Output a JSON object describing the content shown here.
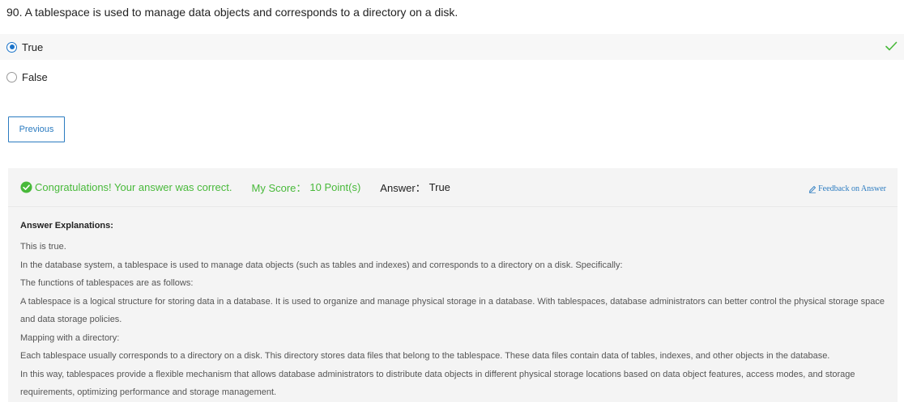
{
  "question": {
    "text": "90. A tablespace is used to manage data objects and corresponds to a directory on a disk."
  },
  "options": [
    {
      "label": "True",
      "selected": true,
      "correct": true
    },
    {
      "label": "False",
      "selected": false,
      "correct": false
    }
  ],
  "nav": {
    "previous_label": "Previous"
  },
  "result": {
    "congrats": "Congratulations! Your answer was correct.",
    "score_label": "My Score：",
    "score_value": "10 Point(s)",
    "answer_label": "Answer：",
    "answer_value": "True",
    "feedback_label": "Feedback on Answer"
  },
  "explanation": {
    "title": "Answer Explanations:",
    "paragraphs": [
      "This is true.",
      "In the database system, a tablespace is used to manage data objects (such as tables and indexes) and corresponds to a directory on a disk. Specifically:",
      "The functions of tablespaces are as follows:",
      "A tablespace is a logical structure for storing data in a database. It is used to organize and manage physical storage in a database. With tablespaces, database administrators can better control the physical storage space and data storage policies.",
      "Mapping with a directory:",
      "Each tablespace usually corresponds to a directory on a disk. This directory stores data files that belong to the tablespace. These data files contain data of tables, indexes, and other objects in the database.",
      "In this way, tablespaces provide a flexible mechanism that allows database administrators to distribute data objects in different physical storage locations based on data object features, access modes, and storage requirements, optimizing performance and storage management."
    ]
  },
  "colors": {
    "accent": "#2b7bc0",
    "correct": "#48b93a",
    "panel_bg": "#f4f4f4"
  },
  "icons": {
    "correct_mark": "checkmark-icon",
    "success": "check-circle-icon",
    "feedback": "pencil-icon"
  }
}
